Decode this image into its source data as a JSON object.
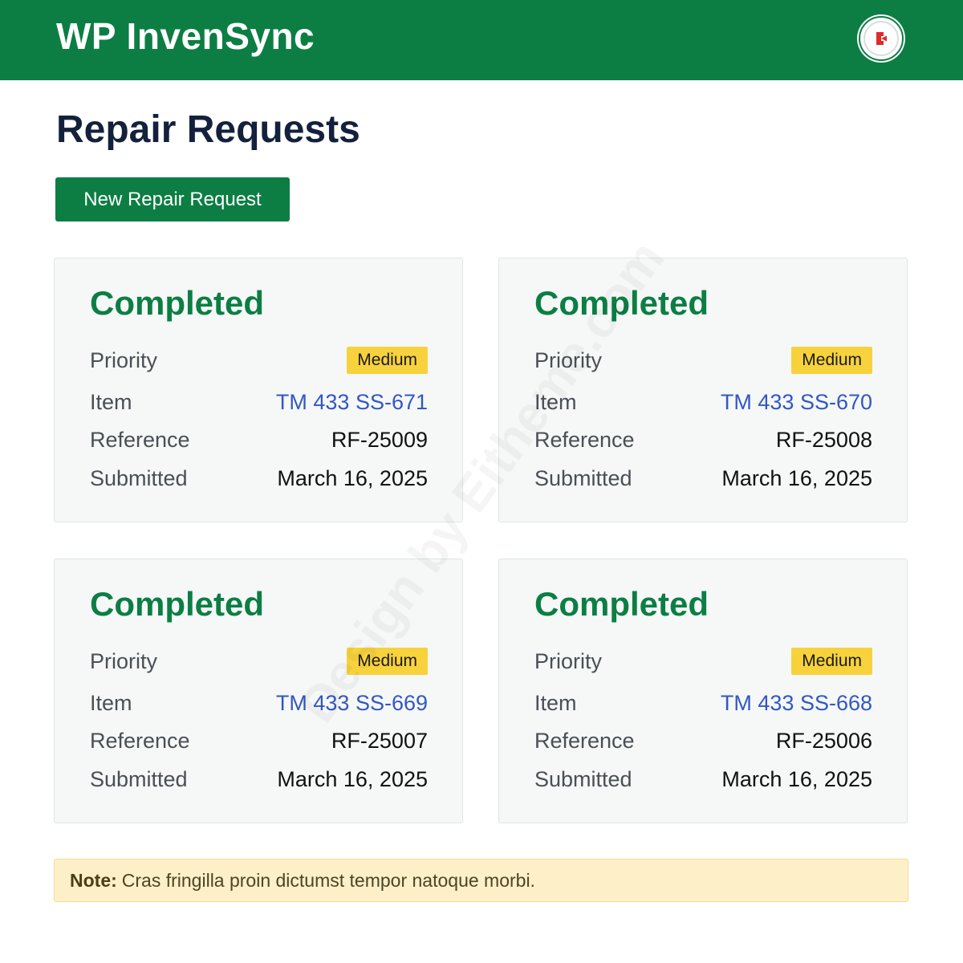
{
  "app": {
    "title": "WP InvenSync",
    "colors": {
      "brand": "#0c7e44",
      "badge_medium": "#f7d23d",
      "link": "#3356c6"
    }
  },
  "header": {
    "avatar_icon": "logout-icon"
  },
  "page": {
    "title": "Repair Requests",
    "new_button_label": "New Repair Request"
  },
  "labels": {
    "priority": "Priority",
    "item": "Item",
    "reference": "Reference",
    "submitted": "Submitted"
  },
  "requests": [
    {
      "status": "Completed",
      "priority": "Medium",
      "item": "TM 433 SS-671",
      "reference": "RF-25009",
      "submitted": "March 16, 2025"
    },
    {
      "status": "Completed",
      "priority": "Medium",
      "item": "TM 433 SS-670",
      "reference": "RF-25008",
      "submitted": "March 16, 2025"
    },
    {
      "status": "Completed",
      "priority": "Medium",
      "item": "TM 433 SS-669",
      "reference": "RF-25007",
      "submitted": "March 16, 2025"
    },
    {
      "status": "Completed",
      "priority": "Medium",
      "item": "TM 433 SS-668",
      "reference": "RF-25006",
      "submitted": "March 16, 2025"
    }
  ],
  "note": {
    "label": "Note:",
    "text": "Cras fringilla proin dictumst tempor natoque morbi."
  },
  "watermark": "Design by Eitheme.com"
}
